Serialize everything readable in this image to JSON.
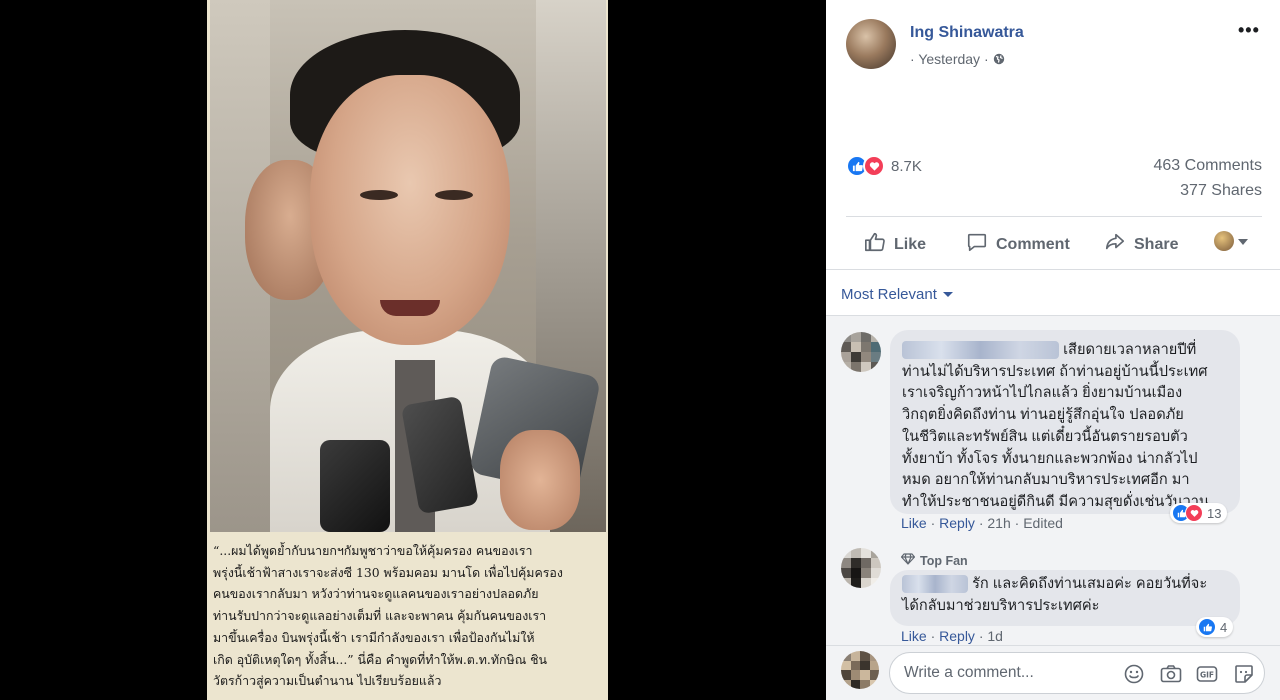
{
  "post": {
    "author": "Ing Shinawatra",
    "time": "Yesterday",
    "visibility_icon": "globe-icon",
    "more_label": "•••"
  },
  "reactions": {
    "count": "8.7K",
    "types": [
      "like",
      "love"
    ],
    "comments": "463 Comments",
    "shares": "377 Shares"
  },
  "actions": {
    "like": "Like",
    "comment": "Comment",
    "share": "Share"
  },
  "sort": {
    "label": "Most Relevant"
  },
  "clipping": {
    "caption_lines": [
      "“...ผมได้พูดย้ำกับนายกฯกัมพูชาว่าขอให้คุ้มครอง   คนของเรา",
      "พรุ่งนี้เช้าฟ้าสางเราจะส่งซี 130 พร้อมคอม มานโด เพื่อไปคุ้มครอง",
      "คนของเรากลับมา   หวังว่าท่านจะดูแลคนของเราอย่างปลอดภัย",
      "ท่านรับปากว่าจะดูแลอย่างเต็มที่   และจะพาคน  คุ้มกันคนของเรา",
      "มาขึ้นเครื่อง  บินพรุ่งนี้เช้า  เรามีกำลังของเรา  เพื่อป้องกันไม่ให้",
      "เกิด  อุบัติเหตุใดๆ  ทั้งสิ้น...”  นี่คือ  คำพูดที่ทำให้พ.ต.ท.ทักษิณ  ชิน",
      "วัตรก้าวสู่ความเป็นตำนาน  ไปเรียบร้อยแล้ว"
    ]
  },
  "comments": [
    {
      "text_lines": [
        "เสียดายเวลาหลายปีที่",
        "ท่านไม่ได้บริหารประเทศ ถ้าท่านอยู่บ้านนี้ประเทศ",
        "เราเจริญก้าวหน้าไปไกลแล้ว ยิ่งยามบ้านเมือง",
        "วิกฤตยิ่งคิดถึงท่าน ท่านอยู่รู้สึกอุ่นใจ ปลอดภัย",
        "ในชีวิตและทรัพย์สิน แต่เดี๋ยวนี้อันตรายรอบตัว",
        "ทั้งยาบ้า ทั้งโจร ทั้งนายกและพวกพ้อง น่ากลัวไป",
        "หมด อยากให้ท่านกลับมาบริหารประเทศอีก มา",
        "ทำให้ประชาชนอยู่ดีกินดี มีความสุขดั่งเช่นวันวาน"
      ],
      "like_label": "Like",
      "reply_label": "Reply",
      "time": "21h",
      "edited": "Edited",
      "reaction_count": "13"
    },
    {
      "badge": "Top Fan",
      "text_lines": [
        "รัก และคิดถึงท่านเสมอค่ะ คอยวันที่จะ",
        "ได้กลับมาช่วยบริหารประเทศค่ะ"
      ],
      "like_label": "Like",
      "reply_label": "Reply",
      "time": "1d",
      "reaction_count": "4"
    }
  ],
  "composer": {
    "placeholder": "Write a comment...",
    "icons": [
      "emoji-icon",
      "camera-icon",
      "gif-icon",
      "sticker-icon"
    ]
  },
  "colors": {
    "link_blue": "#365899",
    "like_blue": "#1877f2",
    "love_red": "#f33e58",
    "secondary_text": "#606770"
  }
}
